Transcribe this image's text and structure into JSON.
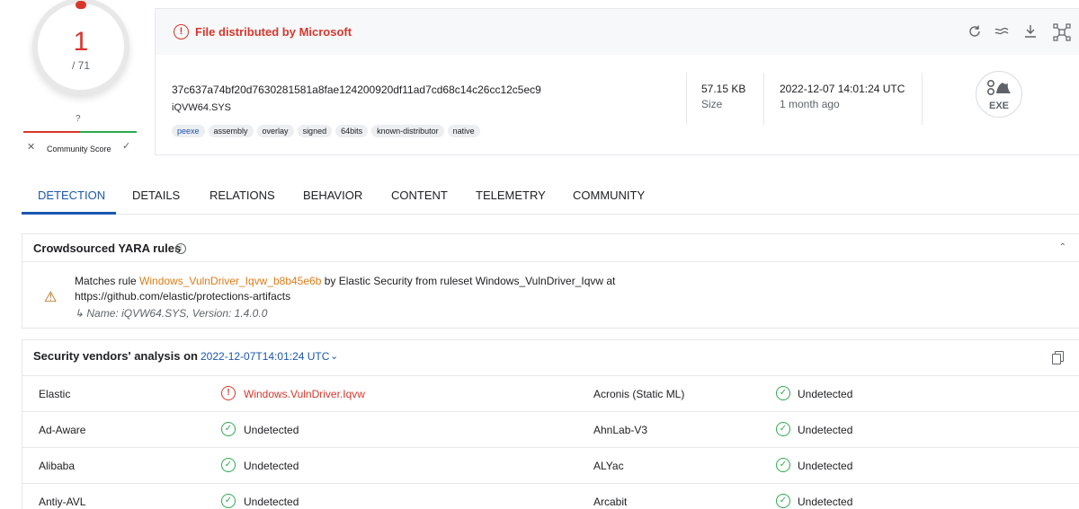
{
  "score": {
    "detections": "1",
    "total": "/ 71"
  },
  "community": {
    "question": "?",
    "label": "Community Score",
    "dislike_icon": "x-icon",
    "like_icon": "check-icon"
  },
  "file": {
    "alert": "File distributed by Microsoft",
    "hash": "37c637a74bf20d7630281581a8fae124200920df11ad7cd68c14c26cc12c5ec9",
    "name": "iQVW64.SYS",
    "tags": [
      "peexe",
      "assembly",
      "overlay",
      "signed",
      "64bits",
      "known-distributor",
      "native"
    ],
    "size_value": "57.15 KB",
    "size_label": "Size",
    "date_value": "2022-12-07 14:01:24 UTC",
    "date_label": "1 month ago",
    "type_badge": "EXE",
    "toolbar_icons": [
      "reanalyze-icon",
      "similar-icon",
      "download-icon",
      "graph-icon"
    ]
  },
  "tabs": [
    "DETECTION",
    "DETAILS",
    "RELATIONS",
    "BEHAVIOR",
    "CONTENT",
    "TELEMETRY",
    "COMMUNITY"
  ],
  "yara": {
    "title": "Crowdsourced YARA rules",
    "prefix": "Matches rule ",
    "rule": "Windows_VulnDriver_Iqvw_b8b45e6b",
    "suffix": " by Elastic Security from ruleset Windows_VulnDriver_Iqvw at",
    "url": "https://github.com/elastic/protections-artifacts",
    "meta": "↳ Name: iQVW64.SYS, Version: 1.4.0.0"
  },
  "vendors": {
    "title": "Security vendors' analysis on",
    "date": "2022-12-07T14:01:24 UTC",
    "rows": [
      {
        "left_name": "Elastic",
        "left_result": "Windows.VulnDriver.Iqvw",
        "left_status": "malicious",
        "right_name": "Acronis (Static ML)",
        "right_result": "Undetected",
        "right_status": "undetected"
      },
      {
        "left_name": "Ad-Aware",
        "left_result": "Undetected",
        "left_status": "undetected",
        "right_name": "AhnLab-V3",
        "right_result": "Undetected",
        "right_status": "undetected"
      },
      {
        "left_name": "Alibaba",
        "left_result": "Undetected",
        "left_status": "undetected",
        "right_name": "ALYac",
        "right_result": "Undetected",
        "right_status": "undetected"
      },
      {
        "left_name": "Antiy-AVL",
        "left_result": "Undetected",
        "left_status": "undetected",
        "right_name": "Arcabit",
        "right_result": "Undetected",
        "right_status": "undetected"
      }
    ]
  },
  "colors": {
    "malicious": "#d9362b",
    "clean": "#2eaa4f",
    "accent": "#1a56b0",
    "warning": "#e07a16"
  }
}
